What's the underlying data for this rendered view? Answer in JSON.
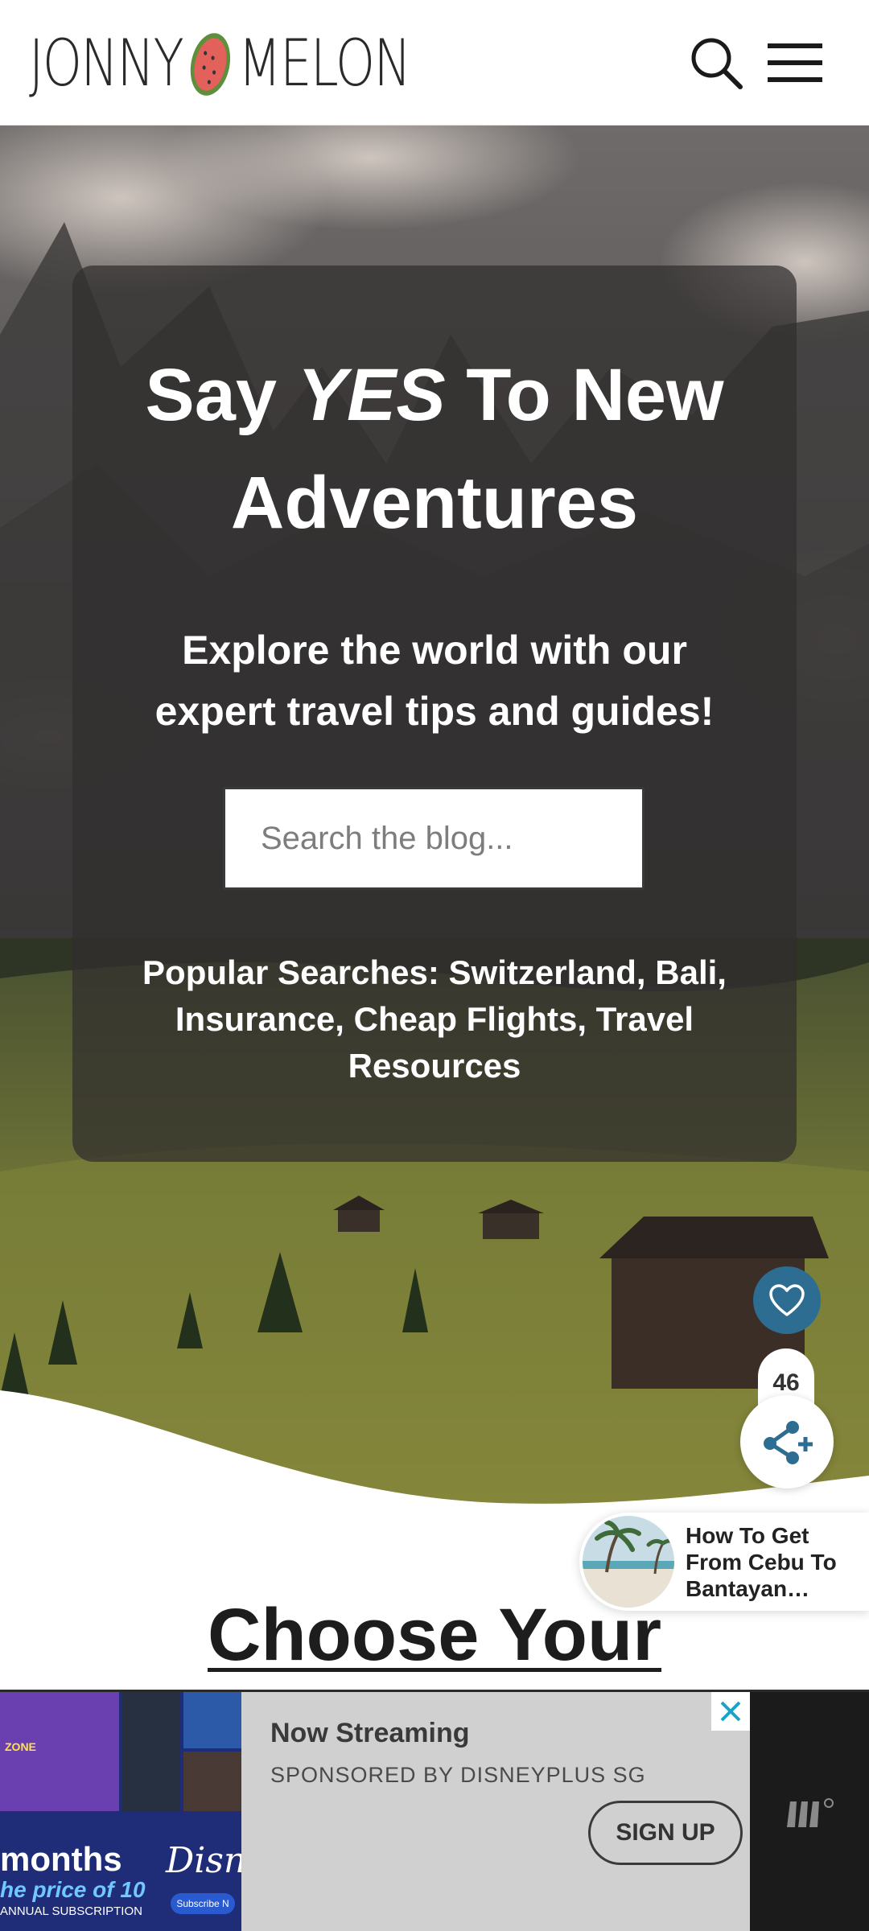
{
  "header": {
    "logo_left": "JONNY",
    "logo_right": "MELON",
    "search_icon": "search-icon",
    "menu_icon": "hamburger-menu-icon"
  },
  "hero": {
    "title_pre": "Say ",
    "title_em": "YES",
    "title_post": " To New Adventures",
    "subtitle": "Explore the world with our expert travel tips and guides!",
    "search_placeholder": "Search the blog...",
    "popular_label": "Popular Searches:",
    "popular_items": [
      "Switzerland",
      "Bali",
      "Insurance",
      "Cheap Flights",
      "Travel Resources"
    ]
  },
  "floating": {
    "like_icon": "heart-icon",
    "like_count": "46",
    "share_icon": "share-icon"
  },
  "related_post": {
    "title": "How To Get From Cebu To Bantayan…"
  },
  "section": {
    "title": "Choose Your"
  },
  "ad": {
    "headline": "Now Streaming",
    "sponsor": "SPONSORED BY DISNEYPLUS SG",
    "cta": "SIGN UP",
    "close_icon": "close-icon",
    "image_months": "months",
    "image_price": "he price of 10",
    "image_annual": "ANNUAL SUBSCRIPTION",
    "image_brand": "Disne",
    "image_button": "Subscribe N",
    "image_zone": "ZONE"
  },
  "colors": {
    "accent": "#2d6d92",
    "card_bg": "rgba(48,46,46,0.72)",
    "ad_bg": "#d0d0d0"
  }
}
